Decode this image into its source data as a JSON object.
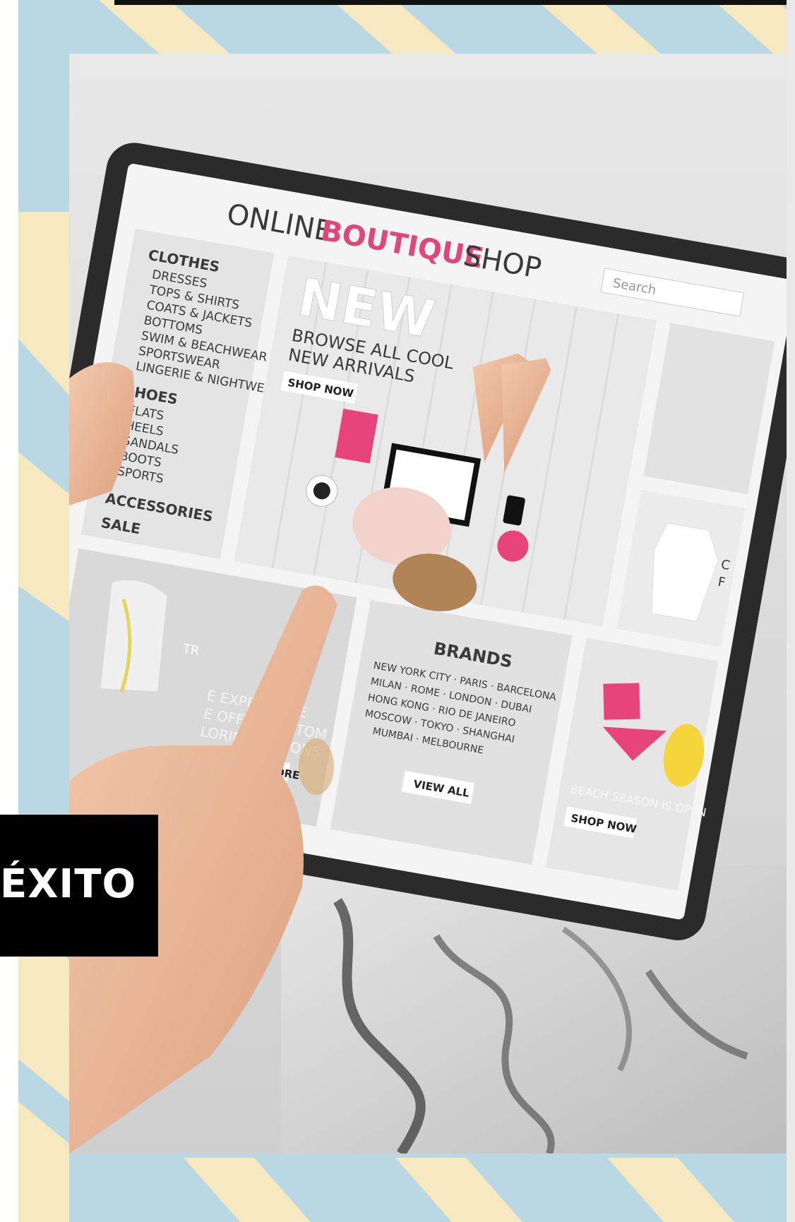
{
  "label": {
    "text": "ÉXITO"
  },
  "tablet": {
    "title_part1": "ONLINE",
    "title_brand": "BOUTIQUE",
    "title_part3": "SHOP",
    "search_placeholder": "Search",
    "menu": {
      "clothes_heading": "CLOTHES",
      "clothes_items": [
        "DRESSES",
        "TOPS & SHIRTS",
        "COATS & JACKETS",
        "BOTTOMS",
        "SWIM & BEACHWEAR",
        "SPORTSWEAR",
        "LINGERIE & NIGHTWEAR"
      ],
      "shoes_heading": "SHOES",
      "shoes_items": [
        "FLATS",
        "HEELS",
        "SANDALS",
        "BOOTS",
        "SPORTS"
      ],
      "accessories": "ACCESSORIES",
      "sale": "SALE"
    },
    "hero": {
      "headline": "NEW",
      "line1": "BROWSE ALL COOL",
      "line2": "NEW ARRIVALS",
      "button": "SHOP NOW"
    },
    "experience": {
      "line1": "E EXPERIENCE",
      "line2": "E OFFER CUSTOM",
      "line3": "LORING OPTIONS",
      "button": "FIND OUT MORE",
      "partial": "TR"
    },
    "brands": {
      "heading": "BRANDS",
      "rows": [
        "NEW YORK CITY · PARIS · BARCELONA",
        "MILAN · ROME · LONDON · DUBAI",
        "HONG KONG · RIO DE JANEIRO",
        "MOSCOW · TOKYO · SHANGHAI",
        "MUMBAI · MELBOURNE"
      ],
      "button": "VIEW ALL"
    },
    "beach": {
      "text": "BEACH SEASON IS OPEN",
      "button": "SHOP NOW"
    },
    "side_partial": {
      "line1": "C",
      "line2": "F"
    }
  },
  "colors": {
    "brand_pink": "#e0457b",
    "stripe_blue": "#b9d8e4",
    "stripe_cream": "#f6e9bf"
  }
}
